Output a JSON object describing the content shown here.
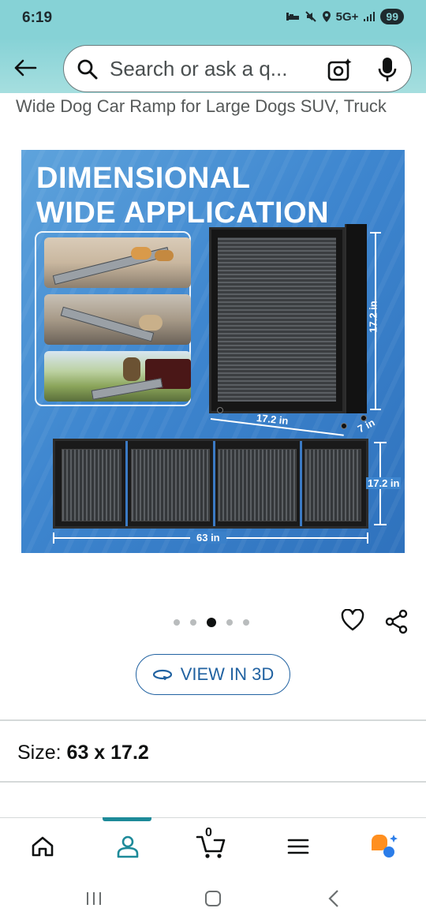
{
  "status_bar": {
    "time": "6:19",
    "network": "5G+",
    "battery": "99"
  },
  "search": {
    "placeholder": "Search or ask a q..."
  },
  "product": {
    "title": "Wide Dog Car Ramp for Large Dogs SUV, Truck"
  },
  "hero_image": {
    "headline_line1": "DIMENSIONAL",
    "headline_line2": "WIDE APPLICATION",
    "dim_height_folded": "17.2 in",
    "dim_width_folded": "17.2 in",
    "dim_depth_folded": "7 in",
    "dim_height_flat": "17.2 in",
    "dim_length_flat": "63 in"
  },
  "carousel": {
    "total": 5,
    "active_index": 2
  },
  "view_3d": {
    "label": "VIEW IN 3D"
  },
  "size": {
    "label": "Size:",
    "value": "63 x 17.2"
  },
  "bottom_nav": {
    "cart_count": "0",
    "active": "account"
  },
  "colors": {
    "accent": "#2162a1",
    "teal": "#1d8a99",
    "status_bar": "#86d2d6"
  }
}
